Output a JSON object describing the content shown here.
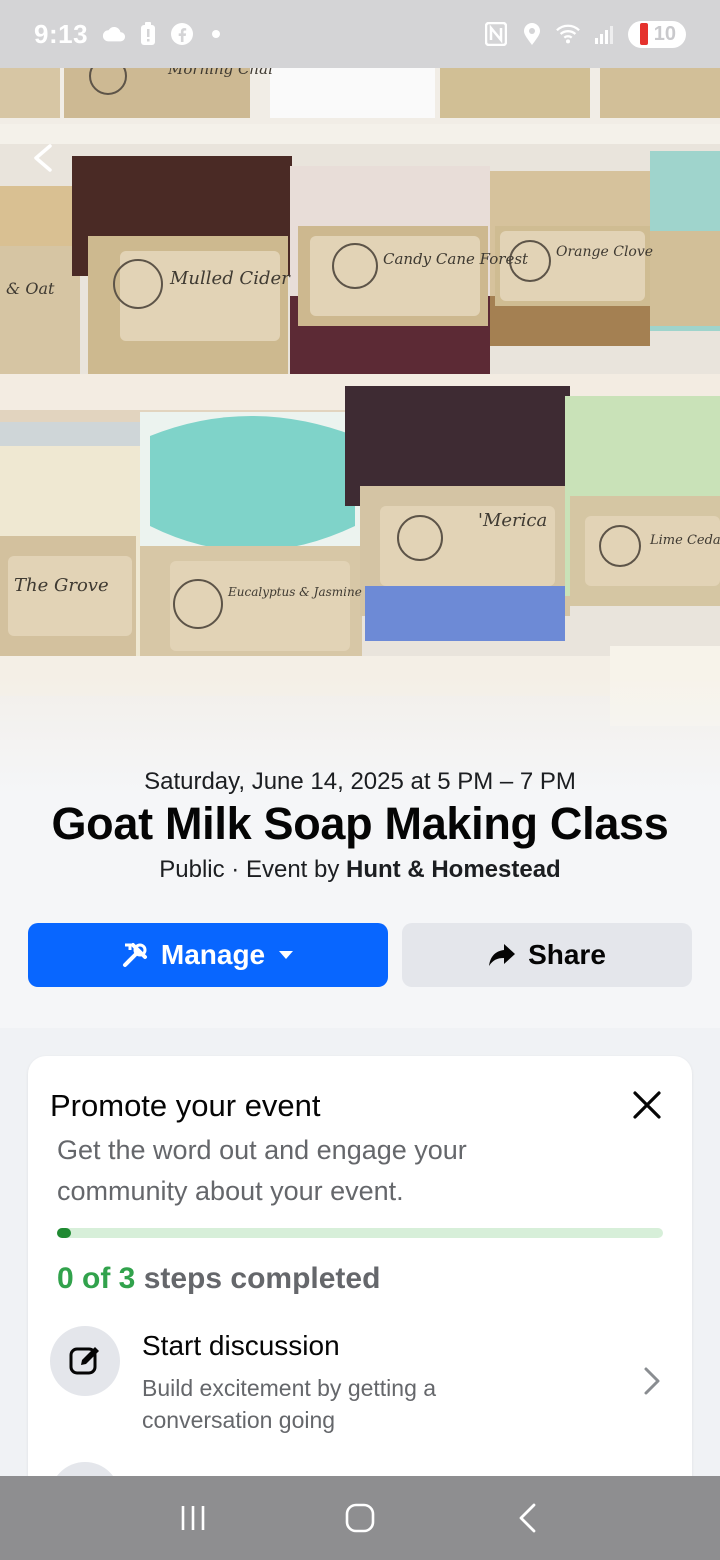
{
  "status_bar": {
    "time": "9:13",
    "left_icons": [
      "cloud-icon",
      "battery-alert-icon",
      "facebook-icon",
      "dot-icon"
    ],
    "right_icons": [
      "nfc-icon",
      "location-icon",
      "wifi-icon",
      "signal-icon"
    ],
    "battery_level": "10"
  },
  "cover": {
    "soap_labels": [
      "Morning Chai",
      "Mulled Cider",
      "Candy Cane Forest",
      "Orange Clove",
      "& Oat",
      "The Grove",
      "Eucalyptus & Jasmine",
      "'Merica",
      "Lime Cedarwood"
    ]
  },
  "event": {
    "date": "Saturday, June 14, 2025 at 5 PM – 7 PM",
    "title": "Goat Milk Soap Making Class",
    "privacy": "Public",
    "separator": " · ",
    "by_prefix": "Event by ",
    "host": "Hunt & Homestead"
  },
  "actions": {
    "manage_label": "Manage",
    "share_label": "Share"
  },
  "promote": {
    "title": "Promote your event",
    "description": "Get the word out and engage your community about your event.",
    "progress_fraction": 0,
    "steps_done": "0 of 3",
    "steps_suffix": " steps completed",
    "tasks": [
      {
        "title": "Start discussion",
        "description": "Build excitement by getting a conversation going"
      }
    ]
  },
  "colors": {
    "primary": "#0866ff",
    "progress_fill": "#1f8a32",
    "progress_track": "#d7efd9",
    "steps_green": "#31a24c",
    "secondary_text": "#65676b"
  }
}
